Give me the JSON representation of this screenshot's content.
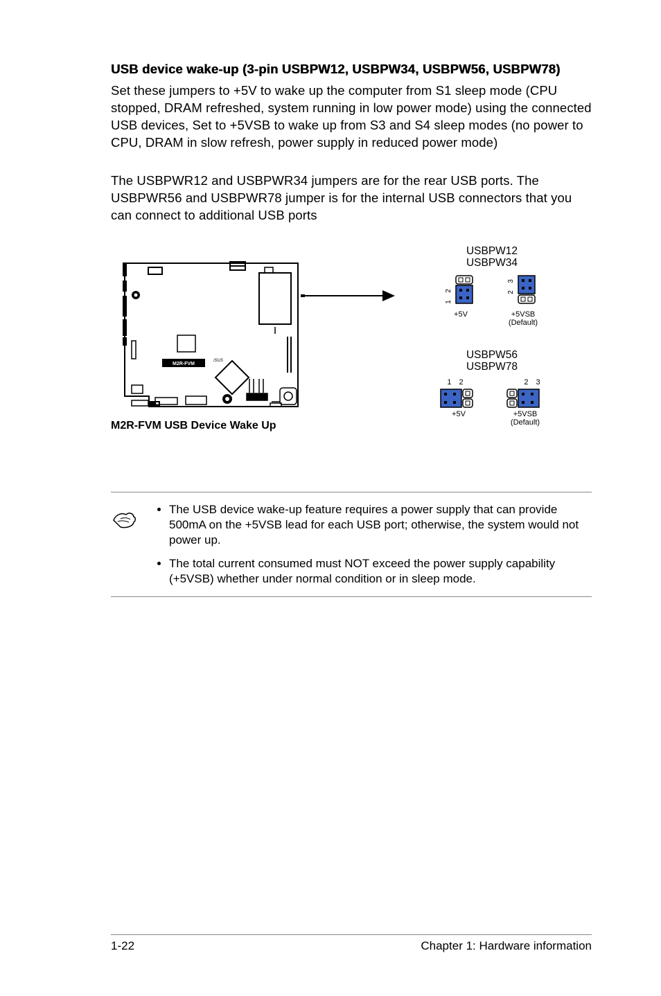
{
  "heading": "USB device wake-up (3-pin USBPW12, USBPW34, USBPW56, USBPW78)",
  "para1": "Set these jumpers to +5V to wake up the computer from S1 sleep mode (CPU stopped, DRAM refreshed, system running in low power mode) using the connected USB devices, Set to +5VSB to wake up from S3 and S4 sleep modes (no power to CPU, DRAM in slow refresh, power supply in reduced power mode)",
  "para2": "The USBPWR12 and USBPWR34 jumpers are for the rear USB ports. The USBPWR56 and USBPWR78 jumper is for the internal USB connectors that you can connect to additional USB ports",
  "diagram": {
    "board_name": "M2R-FVM",
    "caption": "M2R-FVM USB Device Wake Up",
    "groups": [
      {
        "label1": "USBPW12",
        "label2": "USBPW34",
        "orientation": "vertical"
      },
      {
        "label1": "USBPW56",
        "label2": "USBPW78",
        "orientation": "horizontal"
      }
    ],
    "opt5v": "+5V",
    "opt5vsb": "+5VSB",
    "default": "(Default)",
    "pins": {
      "p1": "1",
      "p2": "2",
      "p3": "3"
    }
  },
  "notes": [
    "The USB device wake-up feature requires a power supply that can provide 500mA on the +5VSB lead for each USB port; otherwise, the system would not power up.",
    "The total current consumed must NOT exceed the power supply capability (+5VSB) whether under normal condition or in sleep mode."
  ],
  "footer": {
    "left": "1-22",
    "right": "Chapter 1: Hardware information"
  }
}
